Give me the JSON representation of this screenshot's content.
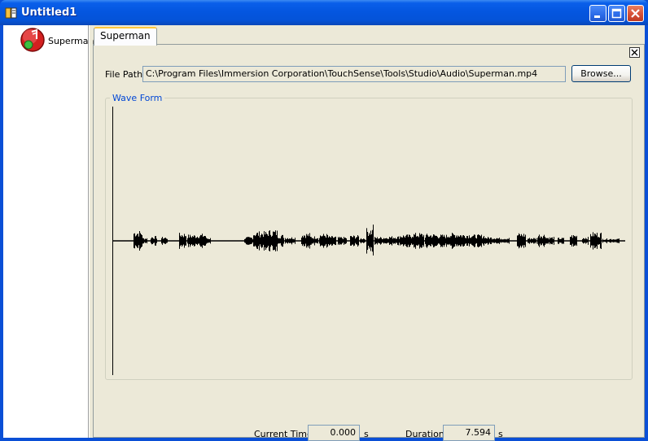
{
  "window": {
    "title": "Untitled1",
    "minimize_icon": "minimize-icon",
    "maximize_icon": "maximize-icon",
    "close_icon": "close-icon"
  },
  "tree": {
    "items": [
      {
        "label": "Superman",
        "icon": "audio-effect-icon"
      }
    ]
  },
  "tabs": [
    {
      "label": "Superman",
      "selected": true
    }
  ],
  "file": {
    "label": "File Path",
    "value": "C:\\Program Files\\Immersion Corporation\\TouchSense\\Tools\\Studio\\Audio\\Superman.mp4",
    "browse_label": "Browse..."
  },
  "waveform": {
    "group_label": "Wave Form",
    "waveform_color": "#000000"
  },
  "timing": {
    "current_label": "Current Time",
    "current_value": "0.000",
    "current_unit": "s",
    "duration_label": "Duration",
    "duration_value": "7.594",
    "duration_unit": "s"
  },
  "colors": {
    "titlebar": "#0456E0",
    "tab_accent": "#FFC83C",
    "legend_text": "#0046D5"
  }
}
